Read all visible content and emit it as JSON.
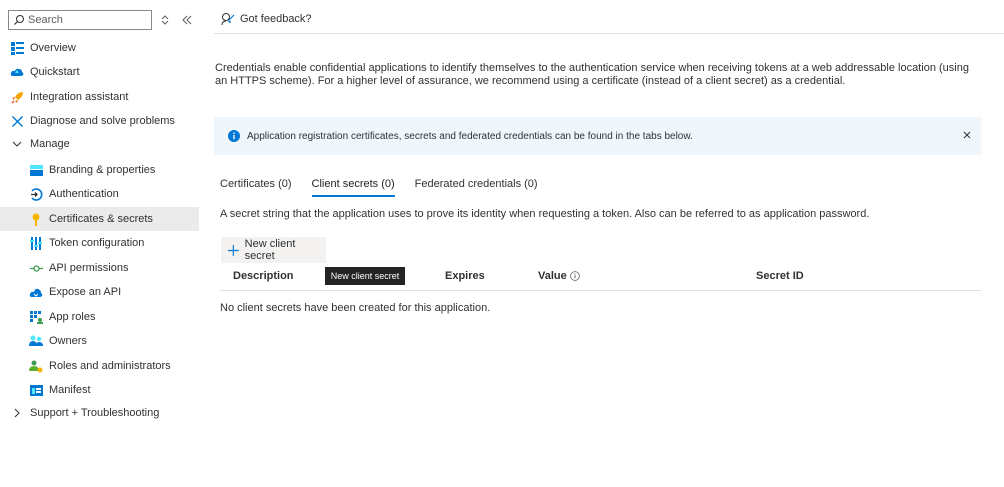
{
  "search": {
    "placeholder": "Search"
  },
  "sidebar": {
    "items": [
      {
        "label": "Overview",
        "icon": "overview-icon"
      },
      {
        "label": "Quickstart",
        "icon": "quickstart-icon"
      },
      {
        "label": "Integration assistant",
        "icon": "rocket-icon"
      },
      {
        "label": "Diagnose and solve problems",
        "icon": "wrench-icon"
      },
      {
        "label": "Manage",
        "icon": "chevron-down-icon"
      },
      {
        "label": "Branding & properties",
        "icon": "branding-icon"
      },
      {
        "label": "Authentication",
        "icon": "authentication-icon"
      },
      {
        "label": "Certificates & secrets",
        "icon": "key-icon"
      },
      {
        "label": "Token configuration",
        "icon": "token-icon"
      },
      {
        "label": "API permissions",
        "icon": "api-permissions-icon"
      },
      {
        "label": "Expose an API",
        "icon": "cloud-icon"
      },
      {
        "label": "App roles",
        "icon": "app-roles-icon"
      },
      {
        "label": "Owners",
        "icon": "owners-icon"
      },
      {
        "label": "Roles and administrators",
        "icon": "roles-icon"
      },
      {
        "label": "Manifest",
        "icon": "manifest-icon"
      },
      {
        "label": "Support + Troubleshooting",
        "icon": "chevron-right-icon"
      }
    ]
  },
  "header": {
    "feedback_label": "Got feedback?"
  },
  "main": {
    "description": "Credentials enable confidential applications to identify themselves to the authentication service when receiving tokens at a web addressable location (using an HTTPS scheme). For a higher level of assurance, we recommend using a certificate (instead of a client secret) as a credential.",
    "info_message": "Application registration certificates, secrets and federated credentials can be found in the tabs below.",
    "tabs": [
      {
        "label": "Certificates (0)"
      },
      {
        "label": "Client secrets (0)"
      },
      {
        "label": "Federated credentials (0)"
      }
    ],
    "secret_description": "A secret string that the application uses to prove its identity when requesting a token. Also can be referred to as application password.",
    "new_secret_label": "New client secret",
    "tooltip": "New client secret",
    "columns": [
      "Description",
      "Expires",
      "Value",
      "Secret ID"
    ],
    "empty_message": "No client secrets have been created for this application."
  },
  "colors": {
    "accent": "#0078d4",
    "active_bg": "#ebebeb",
    "info_bg": "#eff6fc"
  }
}
